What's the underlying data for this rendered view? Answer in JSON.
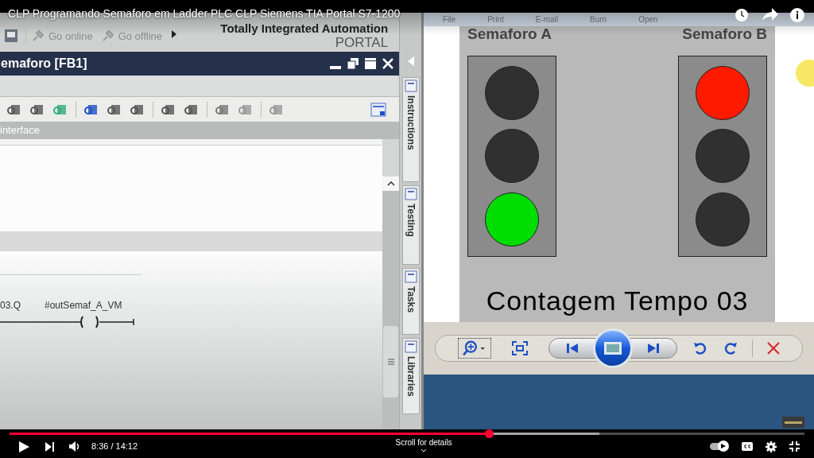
{
  "video": {
    "title": "CLP Programando Semaforo em Ladder PLC CLP Siemens TIA Portal S7-1200",
    "time": "8:36 / 14:12",
    "scroll_hint": "Scroll for details",
    "progress": {
      "level": 0.603
    },
    "buffered": {
      "level": 0.742
    },
    "autoplay": {
      "on": true
    }
  },
  "app": {
    "toolbar": [
      "Go online",
      "Go offline"
    ],
    "brand": [
      "Totally Integrated Automation",
      "PORTAL"
    ],
    "editor_title": "emaforo [FB1]",
    "interface_label": "interface",
    "ladder": {
      "operand": "03.Q",
      "coil": "#outSemaf_A_VM"
    },
    "side_tabs": [
      "Instructions",
      "Testing",
      "Tasks",
      "Libraries"
    ]
  },
  "viewer": {
    "menu": [
      "File",
      "Print",
      "E-mail",
      "Burn",
      "Open"
    ],
    "lights": [
      {
        "label": "Semaforo A",
        "lamps": [
          {
            "color": "#303030"
          },
          {
            "color": "#303030"
          },
          {
            "color": "#00dd00"
          }
        ]
      },
      {
        "label": "Semaforo B",
        "lamps": [
          {
            "color": "#ff1a00"
          },
          {
            "color": "#303030"
          },
          {
            "color": "#303030"
          }
        ]
      }
    ],
    "caption": "Contagem Tempo 03"
  }
}
